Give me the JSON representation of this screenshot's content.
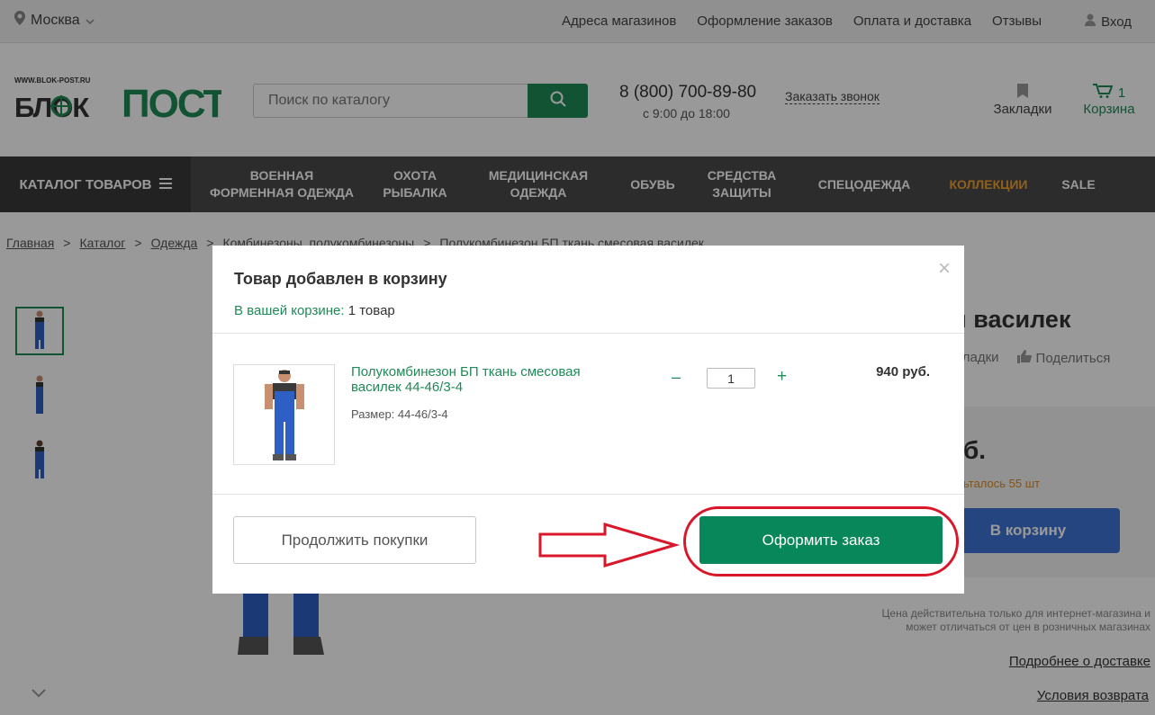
{
  "topbar": {
    "city": "Москва",
    "links": [
      "Адреса магазинов",
      "Оформление заказов",
      "Оплата и доставка",
      "Отзывы"
    ],
    "login": "Вход"
  },
  "header": {
    "logo_url_text": "WWW.BLOK-POST.RU",
    "logo_text_left": "БЛОК",
    "logo_text_right": "ПОСТ",
    "search_placeholder": "Поиск по каталогу",
    "phone": "8 (800) 700-89-80",
    "hours": "с 9:00 до 18:00",
    "callback": "Заказать звонок",
    "bookmarks": "Закладки",
    "cart_label": "Корзина",
    "cart_count": "1"
  },
  "nav": {
    "catalog": "КАТАЛОГ ТОВАРОВ",
    "items": [
      {
        "line1": "ВОЕННАЯ",
        "line2": "ФОРМЕННАЯ ОДЕЖДА"
      },
      {
        "line1": "ОХОТА",
        "line2": "РЫБАЛКА"
      },
      {
        "line1": "МЕДИЦИНСКАЯ",
        "line2": "ОДЕЖДА"
      },
      {
        "line1": "ОБУВЬ",
        "line2": ""
      },
      {
        "line1": "СРЕДСТВА",
        "line2": "ЗАЩИТЫ"
      },
      {
        "line1": "СПЕЦОДЕЖДА",
        "line2": ""
      },
      {
        "line1": "КОЛЛЕКЦИИ",
        "line2": ""
      },
      {
        "line1": "SALE",
        "line2": ""
      }
    ],
    "highlight_color": "#f0a030"
  },
  "breadcrumbs": [
    "Главная",
    "Каталог",
    "Одежда",
    "Комбинезоны, полукомбинезоны",
    "Полукомбинезон БП ткань смесовая василек"
  ],
  "breadcrumb_separator": ">",
  "product_page": {
    "title_fragment": "я василек",
    "bookmarks_fragment": "кладки",
    "share": "Поделиться",
    "price_fragment": "б.",
    "stock_fragment": "ьталось 55 шт",
    "to_cart": "В корзину",
    "note": "Цена действительна только для интернет-магазина и может отличаться от цен в розничных магазинах",
    "delivery_link": "Подробнее о доставке",
    "returns_link": "Условия возврата"
  },
  "modal": {
    "title": "Товар добавлен в корзину",
    "count_label": "В вашей корзине:",
    "count_value": "1 товар",
    "item": {
      "name": "Полукомбинезон БП ткань смесовая василек 44-46/3-4",
      "size": "Размер: 44-46/3-4",
      "qty": "1",
      "minus": "–",
      "plus": "+",
      "price": "940 руб."
    },
    "continue_button": "Продолжить покупки",
    "checkout_button": "Оформить заказ",
    "close": "×"
  },
  "colors": {
    "brand_green": "#1f8a57",
    "checkout_green": "#07875a",
    "annotation_red": "#d9172a",
    "nav_bg": "#4a4a4a"
  }
}
